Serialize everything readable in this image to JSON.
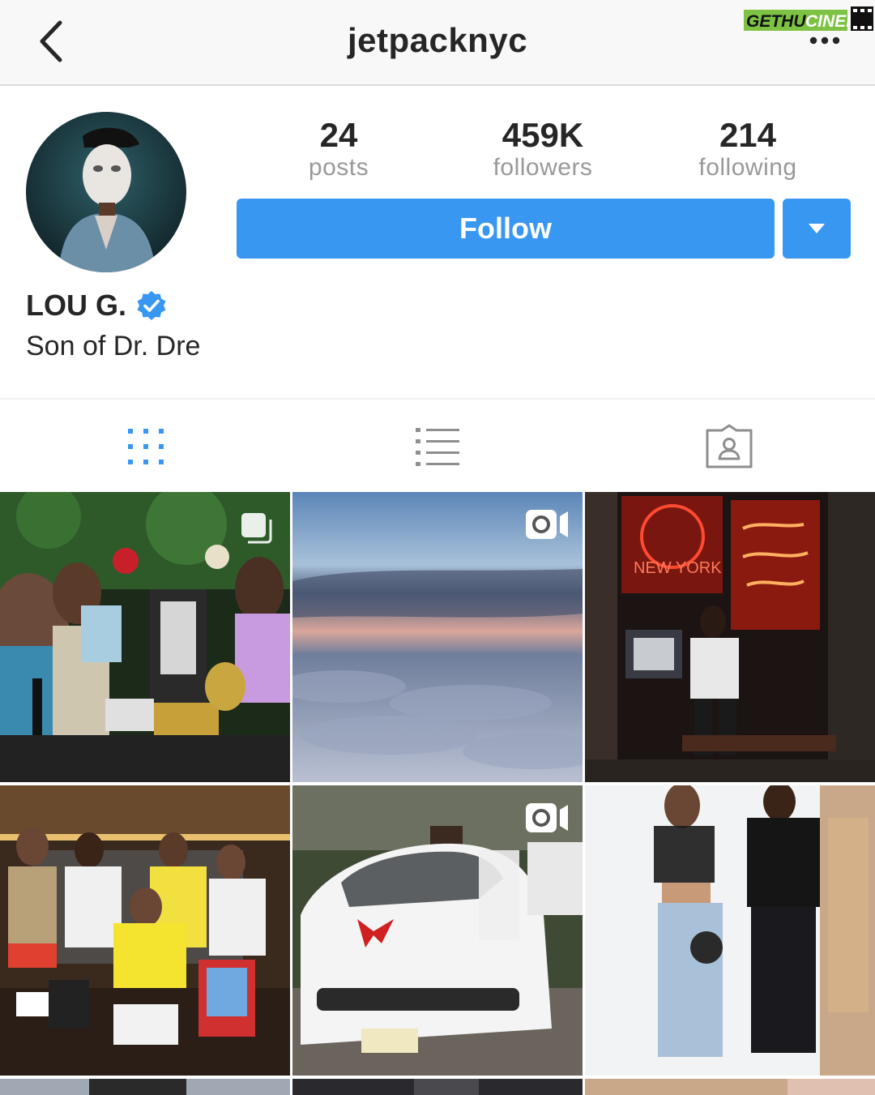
{
  "header": {
    "username": "jetpacknyc",
    "back_icon": "chevron-left-icon",
    "more_icon": "ellipsis-icon",
    "watermark": "GETHU CINEMA"
  },
  "profile": {
    "stats": [
      {
        "value": "24",
        "label": "posts"
      },
      {
        "value": "459K",
        "label": "followers"
      },
      {
        "value": "214",
        "label": "following"
      }
    ],
    "follow_label": "Follow",
    "display_name": "LOU G.",
    "verified": true,
    "bio": "Son of Dr. Dre"
  },
  "tabs": [
    {
      "icon": "grid-icon",
      "active": true
    },
    {
      "icon": "list-icon",
      "active": false
    },
    {
      "icon": "tagged-icon",
      "active": false
    }
  ],
  "posts": [
    {
      "type": "carousel"
    },
    {
      "type": "video"
    },
    {
      "type": "photo"
    },
    {
      "type": "photo"
    },
    {
      "type": "video"
    },
    {
      "type": "photo"
    }
  ],
  "colors": {
    "accent": "#3897f0",
    "verified": "#3897f0",
    "muted_text": "#999999",
    "tab_active": "#3897f0",
    "tab_inactive": "#8e8e8e"
  }
}
